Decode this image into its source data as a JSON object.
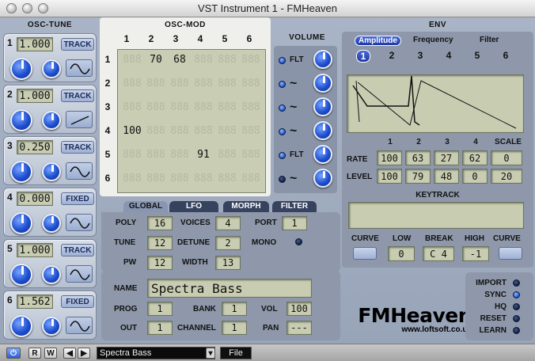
{
  "window": {
    "title": "VST Instrument 1 - FMHeaven"
  },
  "osc_tune": {
    "label": "OSC-TUNE",
    "rows": [
      {
        "num": "1",
        "value": "1.000",
        "mode": "TRACK",
        "wave": "sine-icon"
      },
      {
        "num": "2",
        "value": "1.000",
        "mode": "TRACK",
        "wave": "ramp-icon"
      },
      {
        "num": "3",
        "value": "0.250",
        "mode": "TRACK",
        "wave": "sine-icon"
      },
      {
        "num": "4",
        "value": "0.000",
        "mode": "FIXED",
        "wave": "sine-icon"
      },
      {
        "num": "5",
        "value": "1.000",
        "mode": "TRACK",
        "wave": "sine-icon"
      },
      {
        "num": "6",
        "value": "1.562",
        "mode": "FIXED",
        "wave": "sine-icon"
      }
    ]
  },
  "osc_mod": {
    "label": "OSC-MOD",
    "cols": [
      "1",
      "2",
      "3",
      "4",
      "5",
      "6"
    ],
    "rows": [
      "1",
      "2",
      "3",
      "4",
      "5",
      "6"
    ],
    "cells": [
      [
        "",
        "70",
        "68",
        "",
        "",
        ""
      ],
      [
        "",
        "",
        "",
        "",
        "",
        ""
      ],
      [
        "",
        "",
        "",
        "",
        "",
        ""
      ],
      [
        "100",
        "",
        "",
        "",
        "",
        ""
      ],
      [
        "",
        "",
        "",
        "91",
        "",
        ""
      ],
      [
        "",
        "",
        "",
        "",
        "",
        ""
      ]
    ],
    "ghost": "888"
  },
  "volume": {
    "label": "VOLUME",
    "rows": [
      {
        "type": "FLT",
        "led": "on"
      },
      {
        "type": "~",
        "led": "on"
      },
      {
        "type": "~",
        "led": "on"
      },
      {
        "type": "~",
        "led": "on"
      },
      {
        "type": "FLT",
        "led": "on"
      },
      {
        "type": "~",
        "led": "off"
      }
    ]
  },
  "env": {
    "label": "ENV",
    "tabs": [
      "Amplitude",
      "Frequency",
      "Filter"
    ],
    "active_tab": "Amplitude",
    "numbers": [
      "1",
      "2",
      "3",
      "4",
      "5",
      "6"
    ],
    "active_number": "1",
    "stage_cols": [
      "1",
      "2",
      "3",
      "4",
      "SCALE"
    ],
    "rate_label": "RATE",
    "level_label": "LEVEL",
    "rate": [
      "100",
      "63",
      "27",
      "62",
      "0"
    ],
    "level": [
      "100",
      "79",
      "48",
      "0",
      "20"
    ],
    "keytrack_label": "KEYTRACK",
    "curve_label_left": "CURVE",
    "low_label": "LOW",
    "break_label": "BREAK",
    "high_label": "HIGH",
    "curve_label_right": "CURVE",
    "low": "0",
    "break": "C 4",
    "high": "-1"
  },
  "tabs": [
    "GLOBAL",
    "LFO",
    "MORPH",
    "FILTER"
  ],
  "active_tab": "GLOBAL",
  "global": {
    "poly_label": "POLY",
    "poly": "16",
    "voices_label": "VOICES",
    "voices": "4",
    "port_label": "PORT",
    "port": "1",
    "tune_label": "TUNE",
    "tune": "12",
    "detune_label": "DETUNE",
    "detune": "2",
    "mono_label": "MONO",
    "pw_label": "PW",
    "pw": "12",
    "width_label": "WIDTH",
    "width": "13"
  },
  "patch": {
    "name_label": "NAME",
    "name": "Spectra Bass",
    "prog_label": "PROG",
    "prog": "1",
    "bank_label": "BANK",
    "bank": "1",
    "vol_label": "VOL",
    "vol": "100",
    "out_label": "OUT",
    "out": "1",
    "channel_label": "CHANNEL",
    "channel": "1",
    "pan_label": "PAN",
    "pan": "---"
  },
  "brand": {
    "logo": "FMHeaven",
    "url": "www.loftsoft.co.uk"
  },
  "system": {
    "items": [
      {
        "label": "IMPORT",
        "led": "off"
      },
      {
        "label": "SYNC",
        "led": "on"
      },
      {
        "label": "HQ",
        "led": "off"
      },
      {
        "label": "RESET",
        "led": "off"
      },
      {
        "label": "LEARN",
        "led": "off"
      }
    ]
  },
  "toolbar": {
    "power_icon": "power-icon",
    "r_label": "R",
    "w_label": "W",
    "preset": "Spectra Bass",
    "file_label": "File"
  }
}
